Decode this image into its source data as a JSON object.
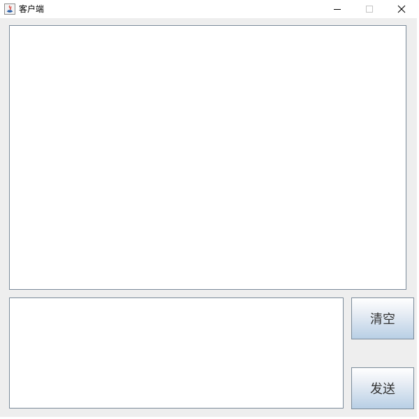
{
  "window": {
    "title": "客户端",
    "controls": {
      "minimize_icon": "minimize-icon",
      "maximize_icon": "maximize-icon",
      "close_icon": "close-icon"
    }
  },
  "chat": {
    "history_text": "",
    "input_text": ""
  },
  "buttons": {
    "clear_label": "清空",
    "send_label": "发送"
  },
  "colors": {
    "content_background": "#eeeeee",
    "button_gradient_top": "#ffffff",
    "button_gradient_bottom": "#b8cfe5",
    "border": "#7a8a99"
  }
}
